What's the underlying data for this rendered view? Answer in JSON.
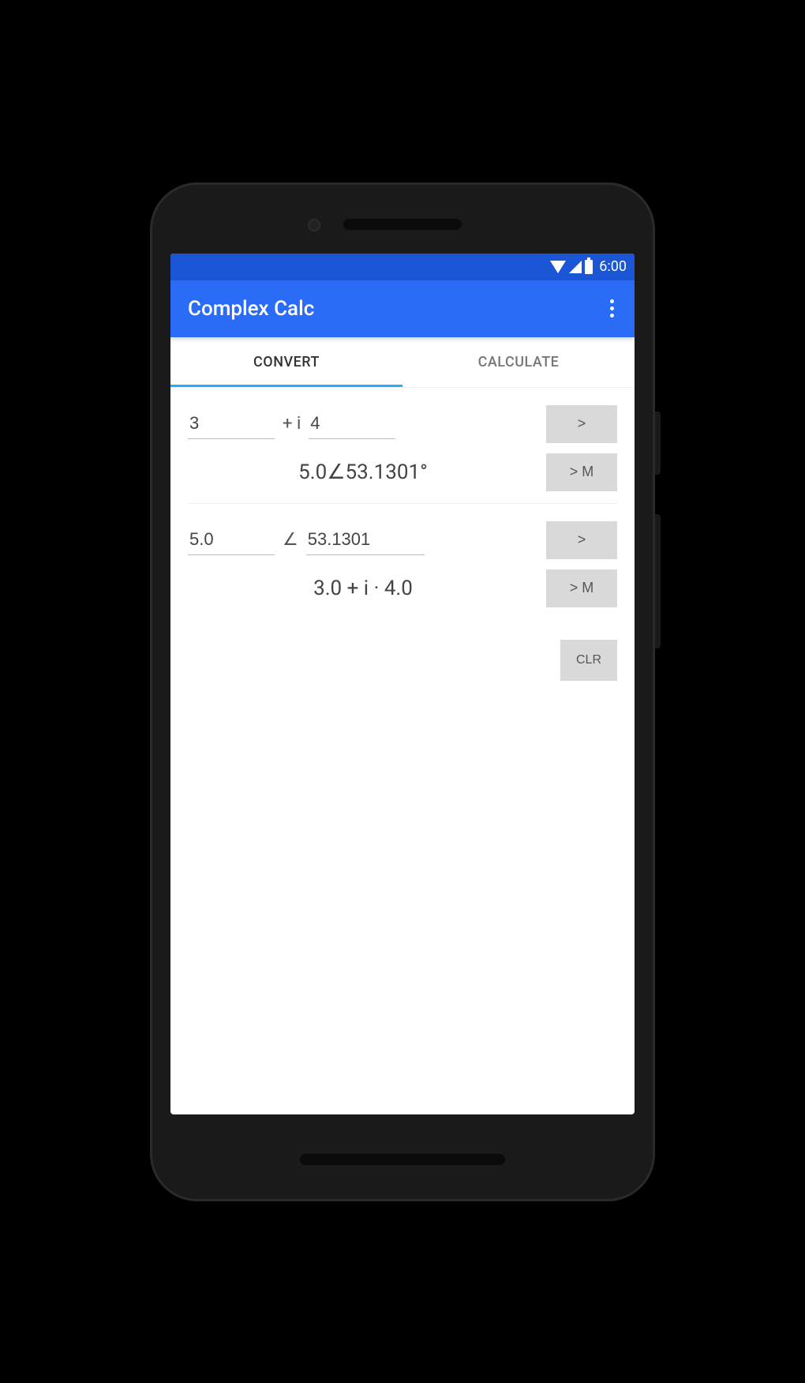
{
  "statusbar": {
    "time": "6:00"
  },
  "appbar": {
    "title": "Complex Calc"
  },
  "tabs": {
    "convert": "CONVERT",
    "calculate": "CALCULATE"
  },
  "rect": {
    "real": "3",
    "sep": "+ i",
    "imag": "4",
    "go": ">"
  },
  "rect_result": {
    "text": "5.0∠53.1301°",
    "mem": "> M"
  },
  "polar": {
    "mag": "5.0",
    "sep": "∠",
    "angle": "53.1301",
    "go": ">"
  },
  "polar_result": {
    "text": "3.0 + i · 4.0",
    "mem": "> M"
  },
  "buttons": {
    "clr": "CLR"
  }
}
